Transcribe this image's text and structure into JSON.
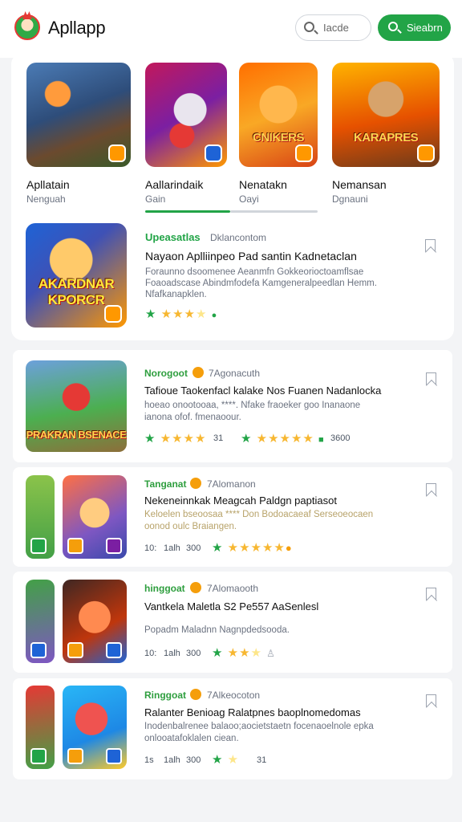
{
  "header": {
    "app_title": "Apllapp",
    "search_placeholder": "Iacde",
    "cta_label": "Sieabrn"
  },
  "featured": {
    "tiles": [
      {
        "name": "Apllatain",
        "sub": "Nenguah",
        "tile_text": "",
        "selected": false
      },
      {
        "name": "Aallarindaik",
        "sub": "Gain",
        "tile_text": "",
        "selected": true
      },
      {
        "name": "Nenatakn",
        "sub": "Oayi",
        "tile_text": "CNIKERS",
        "selected": false
      },
      {
        "name": "Nemansan",
        "sub": "Dgnauni",
        "tile_text": "KARAPRES",
        "selected": false
      }
    ],
    "spotlight": {
      "tile_text": "AKARDNAR KPORCR",
      "tag": "Upeasatlas",
      "meta": "Dklancontom",
      "headline": "Nayaon Aplliinpeo Pad santin Kadnetaclan",
      "description": "Foraunno dsoomenee Aeanmfn Gokkeorioctoamflsae Foaoadscase Abindmfodefa Kamgeneralpeedlan Hemm. Nfafkanapklen.",
      "rating": 3.5
    }
  },
  "list": [
    {
      "tag": "Norogoot",
      "meta": "7Agonacuth",
      "title": "Tafioue Taokenfacl kalake Nos Fuanen Nadanlocka",
      "description": "hoeao onootooaa, ****. Nfake fraoeker goo Inanaone ianona ofof. fmenaoour.",
      "thumb_text": "PRAKRAN BSENACE",
      "foot_rating_a": 4,
      "foot_count": "31",
      "foot_rating_b": 5,
      "foot_extra": "3600"
    },
    {
      "tag": "Tanganat",
      "meta": "7Alomanon",
      "title": "Nekeneinnkak Meagcah Paldgn paptiasot",
      "description": "Keloelen bseoosaa **** Don Bodoacaeaf Serseoeocaen oonod oulc Braiangen.",
      "foot_a": "10:",
      "foot_b": "1alh",
      "foot_c": "300",
      "foot_rating": 5
    },
    {
      "tag": "hinggoat",
      "meta": "7Alomaooth",
      "title": "Vantkela Maletla  S2 Pe557  AaSenlesl",
      "description": "Popadm Maladnn Nagnpdedsooda.",
      "foot_a": "10:",
      "foot_b": "1alh",
      "foot_c": "300",
      "foot_rating": 3
    },
    {
      "tag": "Ringgoat",
      "meta": "7Alkeocoton",
      "title": "Ralanter Benioag Ralatpnes baoplnomedomas",
      "description": "Inodenbalrenee balaoo;aocietstaetn focenaoelnole epka onlooatafoklalen ciean.",
      "foot_a": "1s",
      "foot_b": "1alh",
      "foot_c": "300",
      "foot_rating": 1,
      "foot_count": "31"
    }
  ],
  "colors": {
    "accent": "#22a447",
    "star": "#f7b731",
    "brand_red": "#e53935"
  }
}
